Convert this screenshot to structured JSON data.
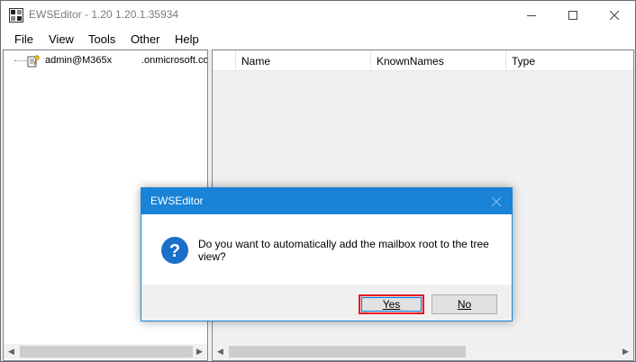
{
  "window": {
    "title": "EWSEditor - 1.20 1.20.1.35934"
  },
  "menu": {
    "file": "File",
    "view": "View",
    "tools": "Tools",
    "other": "Other",
    "help": "Help"
  },
  "tree": {
    "item_label_a": "admin@M365x",
    "item_label_b": ".onmicrosoft.com"
  },
  "grid": {
    "columns": [
      "",
      "Name",
      "KnownNames",
      "Type"
    ]
  },
  "dialog": {
    "title": "EWSEditor",
    "message": "Do you want to automatically add the mailbox root to the tree view?",
    "yes_label": "Yes",
    "no_label": "No"
  },
  "colors": {
    "dialog_accent": "#1883d7",
    "highlight_border": "#e81123",
    "question_icon": "#1a6fc9"
  },
  "icons": {
    "app": "ewseditor-app-icon",
    "tree_node": "mailbox-key-icon",
    "dialog": "question-icon"
  }
}
